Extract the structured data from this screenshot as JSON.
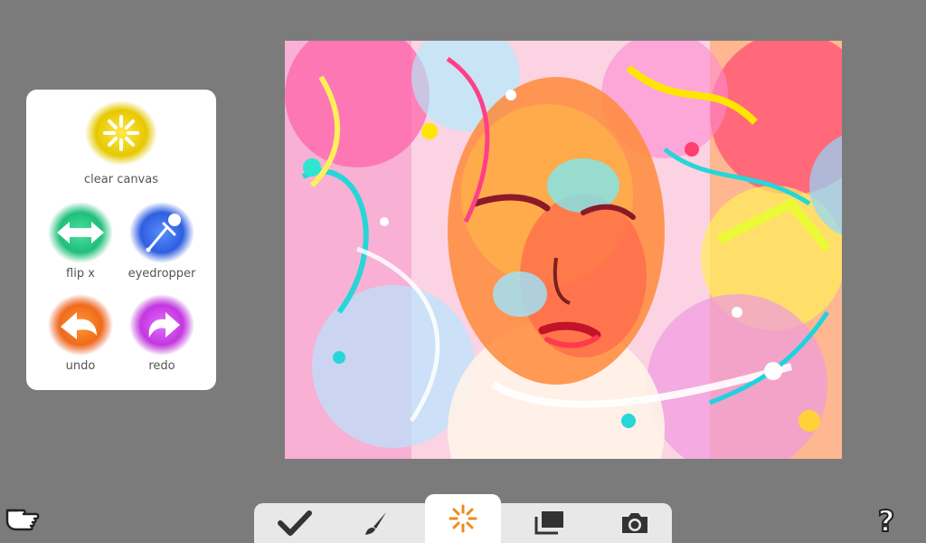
{
  "tools": {
    "clear_canvas": {
      "label": "clear canvas",
      "icon": "clear-canvas-icon",
      "color": "#e6c800"
    },
    "flip_x": {
      "label": "flip x",
      "icon": "flip-horizontal-icon",
      "color": "#1fbf7a"
    },
    "eyedropper": {
      "label": "eyedropper",
      "icon": "eyedropper-icon",
      "color": "#2f5fe0"
    },
    "undo": {
      "label": "undo",
      "icon": "undo-icon",
      "color": "#f06a1a"
    },
    "redo": {
      "label": "redo",
      "icon": "redo-icon",
      "color": "#c437e0"
    }
  },
  "toolbar": {
    "items": [
      {
        "icon": "checkmark-icon",
        "active": false
      },
      {
        "icon": "brush-icon",
        "active": false
      },
      {
        "icon": "sparkle-icon",
        "active": true,
        "color": "#f08a1c"
      },
      {
        "icon": "layers-icon",
        "active": false
      },
      {
        "icon": "camera-icon",
        "active": false
      }
    ]
  },
  "corner_icons": {
    "left": "pointing-hand-icon",
    "right": "help-question-icon"
  },
  "canvas": {
    "content": "abstract colorful painted portrait of a face"
  },
  "colors": {
    "background": "#7b7b7b",
    "panel": "#ffffff",
    "toolbar": "#e8e8e8",
    "accent": "#f08a1c"
  }
}
